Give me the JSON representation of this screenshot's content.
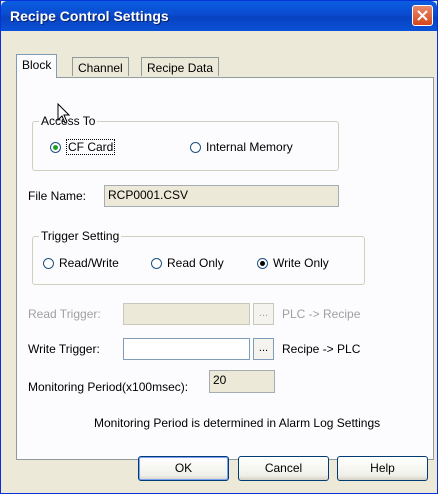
{
  "window": {
    "title": "Recipe Control Settings"
  },
  "tabs": [
    {
      "label": "Block",
      "active": true
    },
    {
      "label": "Channel",
      "active": false
    },
    {
      "label": "Recipe Data",
      "active": false
    }
  ],
  "access_to": {
    "group_label": "Access To",
    "options": [
      {
        "label": "CF Card",
        "selected": true
      },
      {
        "label": "Internal Memory",
        "selected": false
      }
    ]
  },
  "file_name": {
    "label": "File Name:",
    "value": "RCP0001.CSV"
  },
  "trigger_setting": {
    "group_label": "Trigger Setting",
    "options": [
      {
        "label": "Read/Write",
        "selected": false
      },
      {
        "label": "Read Only",
        "selected": false
      },
      {
        "label": "Write Only",
        "selected": true
      }
    ]
  },
  "read_trigger": {
    "label": "Read Trigger:",
    "value": "",
    "browse": "...",
    "direction": "PLC -> Recipe",
    "enabled": false
  },
  "write_trigger": {
    "label": "Write Trigger:",
    "value": "",
    "browse": "...",
    "direction": "Recipe -> PLC",
    "enabled": true
  },
  "monitoring": {
    "label": "Monitoring Period(x100msec):",
    "value": "20"
  },
  "note": "Monitoring Period is determined in Alarm Log Settings",
  "buttons": {
    "ok": "OK",
    "cancel": "Cancel",
    "help": "Help"
  }
}
